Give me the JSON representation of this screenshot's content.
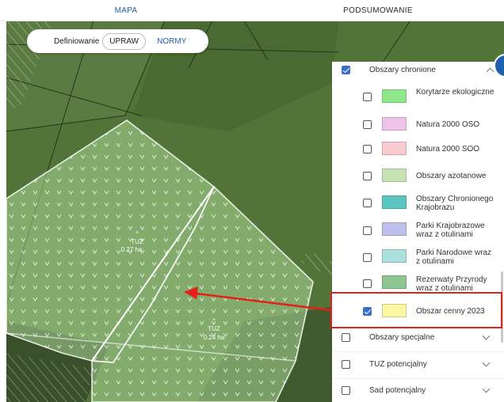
{
  "tabs": [
    {
      "label": "MAPA",
      "active": true
    },
    {
      "label": "PODSUMOWANIE",
      "active": false
    }
  ],
  "mode_switch": {
    "label": "Definiowanie",
    "options": [
      "UPRAW",
      "NORMY"
    ],
    "selected": "UPRAW"
  },
  "map": {
    "parcels": [
      {
        "name": "TUZ",
        "area": "0.27 ha"
      },
      {
        "name": "TUZ",
        "area": "0.24 ha"
      }
    ]
  },
  "layers": {
    "group_title": "Obszary chronione",
    "group_checked": true,
    "group_expanded": true,
    "items": [
      {
        "label": "Korytarze ekologiczne",
        "checked": false,
        "color": "#8ee88a"
      },
      {
        "label": "Natura 2000 OSO",
        "checked": false,
        "color": "#efc2ea"
      },
      {
        "label": "Natura 2000 SOO",
        "checked": false,
        "color": "#f8cbd1"
      },
      {
        "label": "Obszary azotanowe",
        "checked": false,
        "color": "#c9e2b3"
      },
      {
        "label": "Obszary Chronionego Krajobrazu",
        "checked": false,
        "color": "#5dc6c1"
      },
      {
        "label": "Parki Krajobrazowe wraz z otulinami",
        "checked": false,
        "color": "#bcc0ea"
      },
      {
        "label": "Parki Narodowe wraz z otulinami",
        "checked": false,
        "color": "#a9dfdc"
      },
      {
        "label": "Rezerwaty Przyrody wraz z otulinami",
        "checked": false,
        "color": "#8fc58f"
      },
      {
        "label": "Obszar cenny 2023",
        "checked": true,
        "color": "#fbf7a2"
      }
    ],
    "other_groups": [
      {
        "label": "Obszary specjalne",
        "checked": false
      },
      {
        "label": "TUZ potencjalny",
        "checked": false
      },
      {
        "label": "Sad potencjalny",
        "checked": false
      }
    ]
  },
  "colors": {
    "accent": "#1e5fae",
    "highlight": "#e3201b"
  }
}
